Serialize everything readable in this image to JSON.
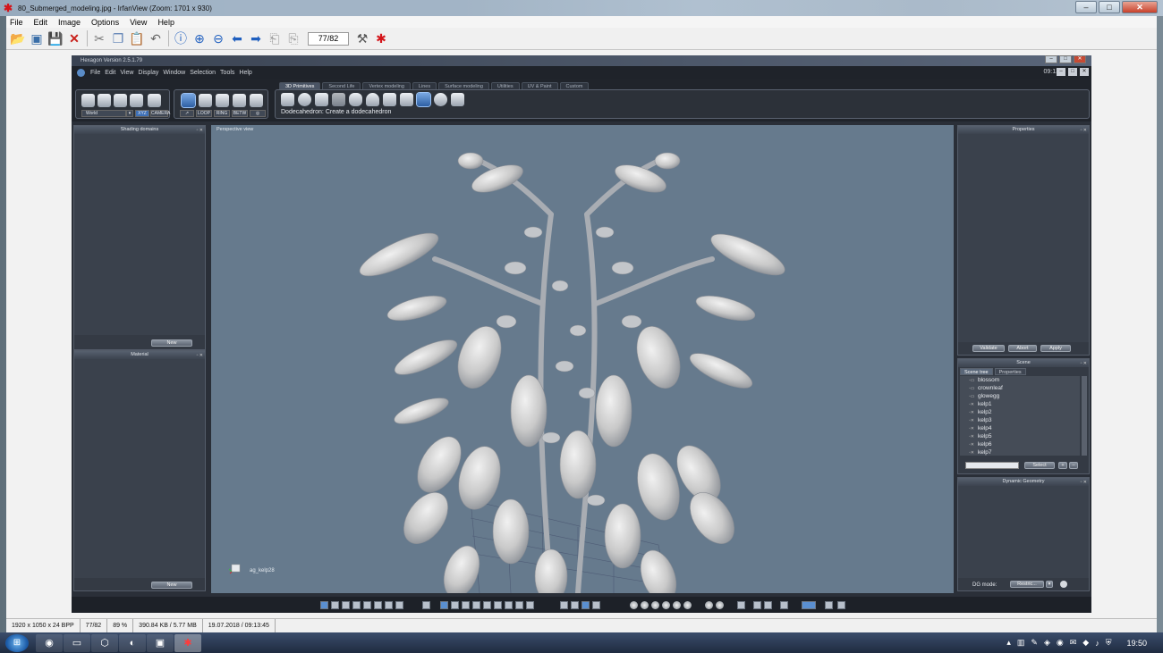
{
  "irfanview": {
    "title": "80_Submerged_modeling.jpg - IrfanView (Zoom: 1701 x 930)",
    "menu": [
      "File",
      "Edit",
      "Image",
      "Options",
      "View",
      "Help"
    ],
    "counter": "77/82",
    "status": [
      "1920 x 1050 x 24 BPP",
      "77/82",
      "89 %",
      "390.84 KB / 5.77 MB",
      "19.07.2018 / 09:13:45"
    ],
    "window_controls": {
      "min": "–",
      "max": "□",
      "close": "✕"
    }
  },
  "hexagon": {
    "title": "Hexagon Version 2.5.1.79",
    "menu": [
      "File",
      "Edit",
      "View",
      "Display",
      "Window",
      "Selection",
      "Tools",
      "Help"
    ],
    "time": "09:13",
    "tabs": [
      "3D Primitives",
      "Second Life",
      "Vertex modeling",
      "Lines",
      "Surface modeling",
      "Utilities",
      "UV & Paint",
      "Custom"
    ],
    "hint": "Dodecahedron: Create a dodecahedron",
    "coord_system": "World",
    "coord_buttons": [
      "XYZ",
      "CAMERA"
    ],
    "select_buttons": [
      "LOOP",
      "RING",
      "BETW"
    ],
    "panels": {
      "shading": {
        "title": "Shading domains",
        "button": "New"
      },
      "material": {
        "title": "Material",
        "button": "New"
      },
      "properties": {
        "title": "Properties",
        "buttons": [
          "Validate",
          "Abort",
          "Apply"
        ]
      },
      "scene": {
        "title": "Scene",
        "tabs": [
          "Scene tree",
          "Properties"
        ],
        "items": [
          "blossom",
          "crownleaf",
          "glowegg",
          "kelp1",
          "kelp2",
          "kelp3",
          "kelp4",
          "kelp5",
          "kelp6",
          "kelp7"
        ],
        "select_button": "Select"
      },
      "dynamic": {
        "title": "Dynamic Geometry",
        "mode_label": "DG mode:",
        "mode_value": "Restric..."
      }
    },
    "viewport": {
      "label": "Perspective view",
      "object": "ag_kelp28"
    }
  },
  "taskbar": {
    "clock": "19:50"
  }
}
